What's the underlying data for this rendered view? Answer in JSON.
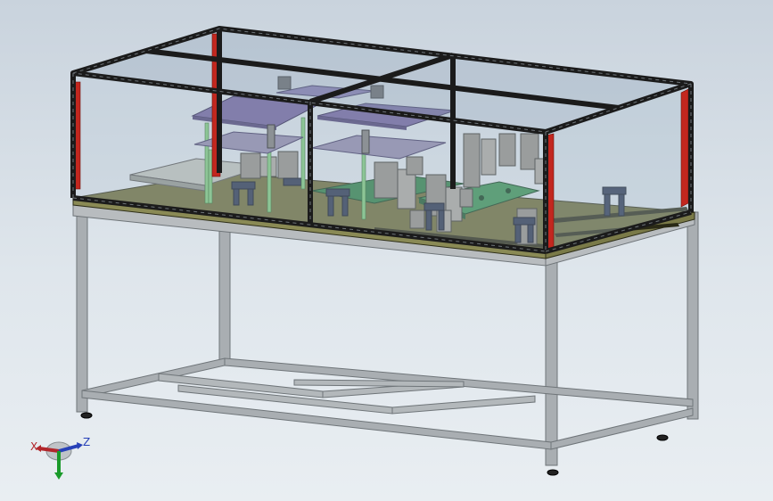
{
  "viewport": {
    "background_top": "#c9d3dd",
    "background_bottom": "#e9eef2"
  },
  "triad": {
    "x_label": "X",
    "z_label": "Z",
    "x_color": "#b1262b",
    "y_color": "#1a9a2a",
    "z_color": "#2741b8"
  },
  "model": {
    "frame_color": "#9aa0a4",
    "enclosure_frame_color": "#1b1b1b",
    "glass_color": "#9fb2c3",
    "plate_color": "#6b6b3a",
    "purple_plate_color": "#6c5f9a",
    "pcb_color": "#2f7d47",
    "post_color": "#7cc47c",
    "red_strip_color": "#c2271f"
  }
}
